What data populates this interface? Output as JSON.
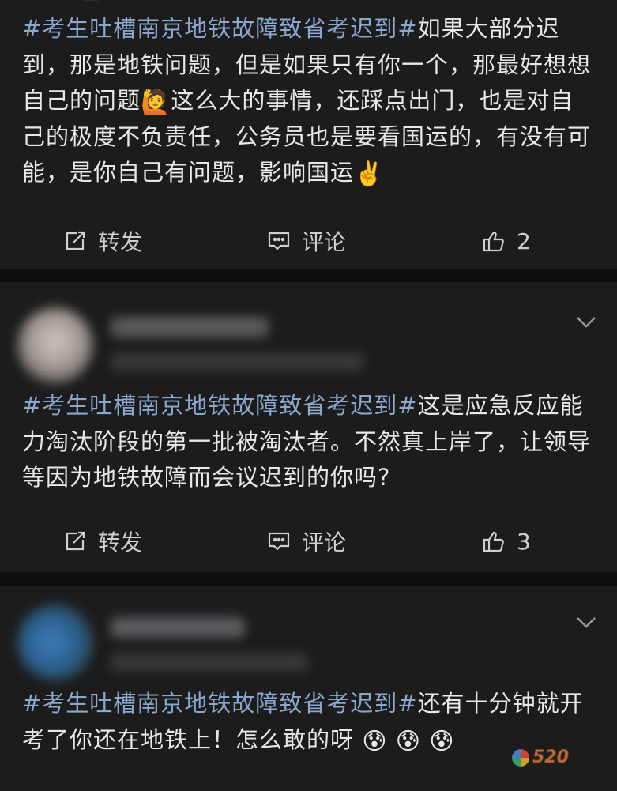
{
  "posts": [
    {
      "topic": "#考生吐槽南京地铁故障致省考迟到#",
      "text_a": "如果大部分迟到，那是地铁问题，但是如果只有你一个，那最好想想自己的问题",
      "emoji_a": "🙋",
      "text_b": "这么大的事情，还踩点出门，也是对自己的极度不负责任，公务员也是要看国运的，有没有可能，是你自己有问题，影响国运",
      "emoji_b": "✌️",
      "repost_label": "转发",
      "comment_label": "评论",
      "like_count": "2"
    },
    {
      "topic": "#考生吐槽南京地铁故障致省考迟到#",
      "text_a": "这是应急反应能力淘汰阶段的第一批被淘汰者。不然真上岸了，让领导等因为地铁故障而会议迟到的你吗?",
      "repost_label": "转发",
      "comment_label": "评论",
      "like_count": "3"
    },
    {
      "topic": "#考生吐槽南京地铁故障致省考迟到#",
      "text_a": "还有十分钟就开考了你还在地铁上！怎么敢的呀",
      "emoji_a": "😰"
    }
  ],
  "watermark_text": "520",
  "colors": {
    "topic": "#8aa7ce",
    "card": "#1c1c1d",
    "background": "#0f0f10"
  }
}
